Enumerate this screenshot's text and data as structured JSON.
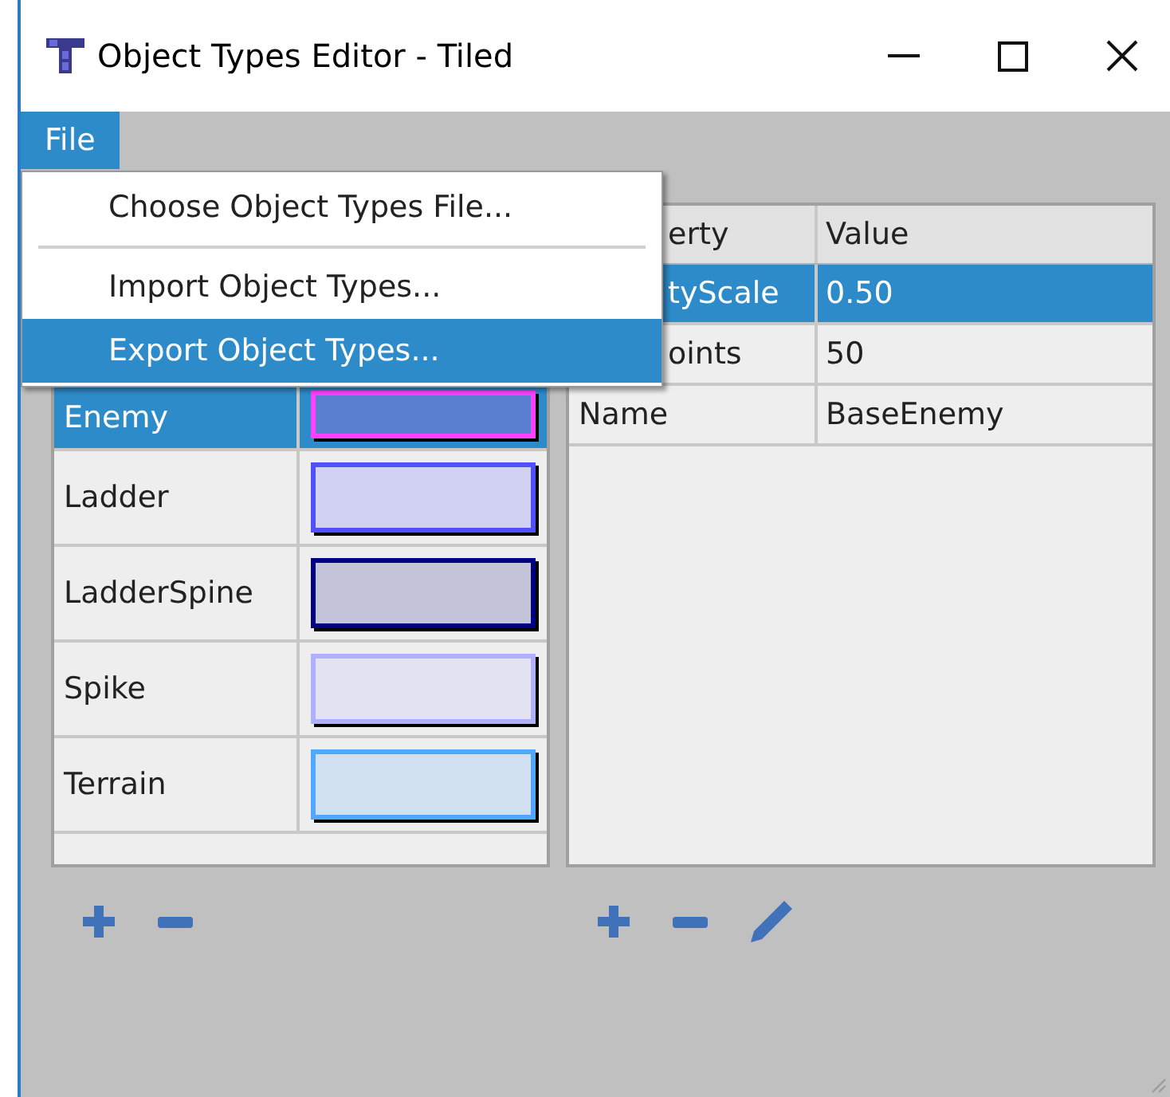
{
  "window": {
    "title": "Object Types Editor - Tiled"
  },
  "menu_bar": [
    {
      "label": "File",
      "selected": true
    }
  ],
  "menu": {
    "items": [
      {
        "kind": "item",
        "label": "Choose Object Types File...",
        "selected": false
      },
      {
        "kind": "separator"
      },
      {
        "kind": "item",
        "label": "Import Object Types...",
        "selected": false
      },
      {
        "kind": "item",
        "label": "Export Object Types...",
        "selected": true
      }
    ]
  },
  "types": [
    {
      "name": "Enemy",
      "color": "#ff40ff",
      "selected": true
    },
    {
      "name": "Ladder",
      "color": "#5050ff",
      "selected": false
    },
    {
      "name": "LadderSpine",
      "color": "#000080",
      "selected": false
    },
    {
      "name": "Spike",
      "color": "#b0b0ff",
      "selected": false
    },
    {
      "name": "Terrain",
      "color": "#50a8ff",
      "selected": false
    }
  ],
  "properties": {
    "columns": [
      "erty",
      "Value"
    ],
    "rows": [
      {
        "property": "tyScale",
        "value": "0.50",
        "selected": true
      },
      {
        "property": "oints",
        "value": "50",
        "selected": false
      },
      {
        "property": "Name",
        "value": "BaseEnemy",
        "selected": false
      }
    ]
  }
}
